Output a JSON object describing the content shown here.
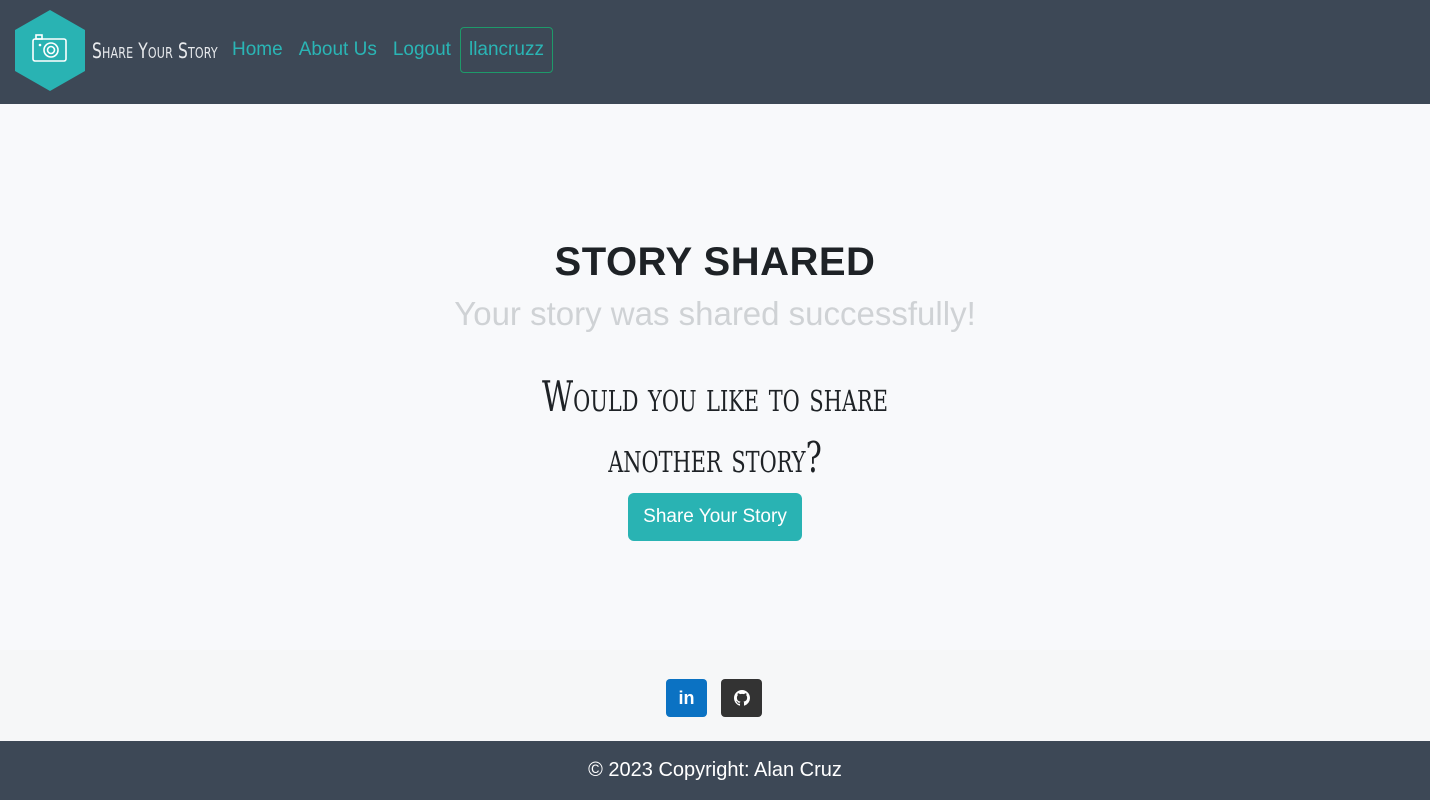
{
  "brand": {
    "name": "Share Your Story",
    "logo_icon": "camera-icon",
    "logo_color": "#29b3b3"
  },
  "nav": {
    "items": [
      {
        "label": "Home"
      },
      {
        "label": "About Us"
      },
      {
        "label": "Logout"
      }
    ],
    "user": "llancruzz"
  },
  "main": {
    "title": "STORY SHARED",
    "subtitle": "Your story was shared successfully!",
    "question_line1": "Would you like to share",
    "question_line2": "another story?",
    "button_label": "Share Your Story"
  },
  "social": {
    "linkedin_icon": "linkedin-icon",
    "linkedin_glyph": "in",
    "linkedin_color": "#0b72c3",
    "github_icon": "github-icon",
    "github_color": "#333333"
  },
  "footer": {
    "text": "© 2023 Copyright: Alan Cruz"
  },
  "colors": {
    "navbar": "#3d4856",
    "accent": "#29b3b3",
    "page_bg": "#f8f9fb"
  }
}
